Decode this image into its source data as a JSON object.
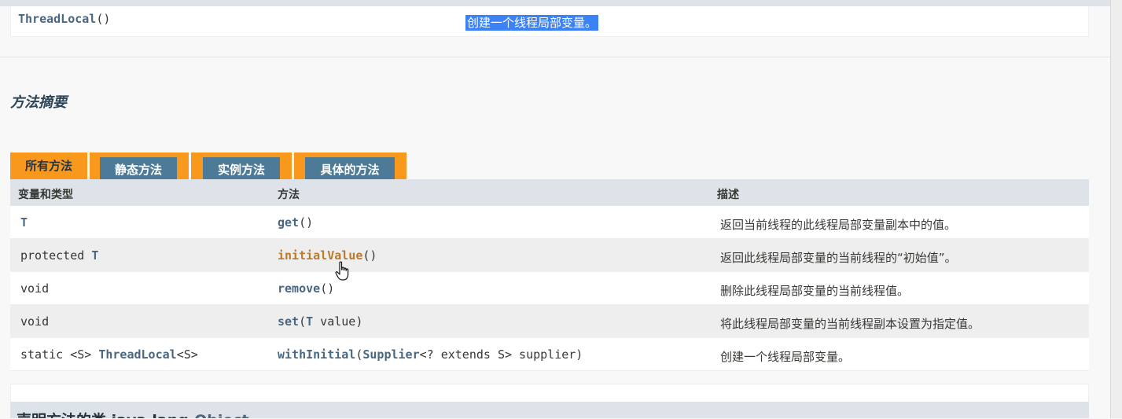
{
  "constructor_row": {
    "name": "ThreadLocal",
    "params": "()",
    "description": "创建一个线程局部变量。"
  },
  "section_title": "方法摘要",
  "tabs": [
    {
      "label": "所有方法",
      "active": true
    },
    {
      "label": "静态方法",
      "active": false
    },
    {
      "label": "实例方法",
      "active": false
    },
    {
      "label": "具体的方法",
      "active": false
    }
  ],
  "table": {
    "headers": [
      "变量和类型",
      "方法",
      "描述"
    ],
    "rows": [
      {
        "type_prefix": "",
        "type_bold": "T",
        "type_suffix": "",
        "method_name": "get",
        "method_args_bold": "",
        "method_args": "()",
        "description": "返回当前线程的此线程局部变量副本中的值。"
      },
      {
        "type_prefix": "protected ",
        "type_bold": "T",
        "type_suffix": "",
        "method_name": "initialValue",
        "method_args_bold": "",
        "method_args": "()",
        "description": "返回此线程局部变量的当前线程的“初始值”。"
      },
      {
        "type_prefix": "void",
        "type_bold": "",
        "type_suffix": "",
        "method_name": "remove",
        "method_args_bold": "",
        "method_args": "()",
        "description": "删除此线程局部变量的当前线程值。"
      },
      {
        "type_prefix": "void",
        "type_bold": "",
        "type_suffix": "",
        "method_name": "set",
        "method_args_pre": "(",
        "method_args_bold": "T",
        "method_args": " value)",
        "description": "将此线程局部变量的当前线程副本设置为指定值。"
      },
      {
        "type_prefix": "static <S> ",
        "type_bold": "ThreadLocal",
        "type_suffix": "<S>",
        "method_name": "withInitial",
        "method_args_pre": "(",
        "method_args_bold": "Supplier",
        "method_args": "<? extends S> supplier)",
        "description": "创建一个线程局部变量。"
      }
    ]
  },
  "inherited": {
    "prefix": "声明方法的类 java.lang.",
    "link": "Object"
  },
  "colors": {
    "tab_orange": "#f8981d",
    "tab_blue": "#4d7a97",
    "link_blue": "#4a6782",
    "hover_link": "#bb7a2a",
    "selection": "#3b82f6"
  },
  "cursor_icon": "hand-pointer-icon"
}
